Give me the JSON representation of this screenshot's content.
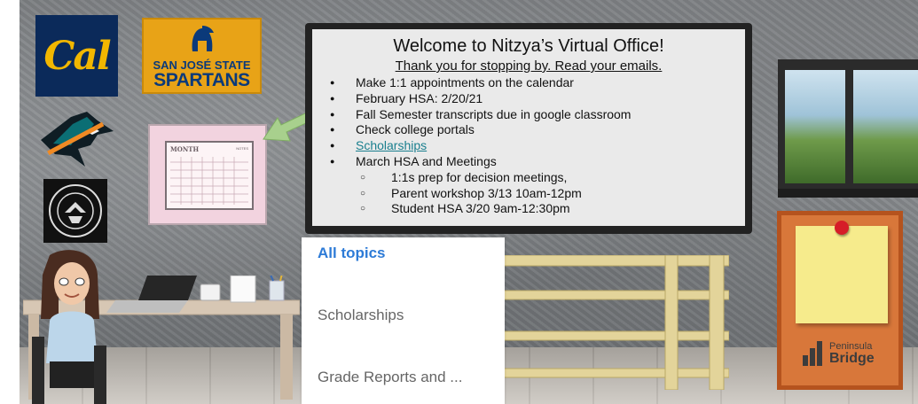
{
  "board": {
    "title": "Welcome to Nitzya’s Virtual Office!",
    "subtitle": "Thank you for stopping by.  Read your emails.",
    "items": [
      {
        "text": "Make 1:1 appointments on the calendar",
        "level": 1
      },
      {
        "text": "February HSA: 2/20/21",
        "level": 1
      },
      {
        "text": "Fall Semester transcripts due in google classroom",
        "level": 1
      },
      {
        "text": "Check college portals",
        "level": 1
      },
      {
        "text": "Scholarships",
        "level": 1,
        "link": true
      },
      {
        "text": "March HSA and Meetings",
        "level": 1
      },
      {
        "text": "1:1s prep for decision meetings,",
        "level": 2
      },
      {
        "text": "Parent workshop 3/13 10am-12pm",
        "level": 2
      },
      {
        "text": "Student HSA 3/20 9am-12:30pm",
        "level": 2
      }
    ]
  },
  "logos": {
    "cal": "Cal",
    "sjsu_line1": "SAN JOSÉ STATE",
    "sjsu_line2": "SPARTANS",
    "shark": "sharks-logo-icon",
    "seal": "association-seal-icon"
  },
  "calendar": {
    "month_label": "MONTH",
    "notes_label": "NOTES"
  },
  "corkboard": {
    "brand_line1": "Peninsula",
    "brand_line2": "Bridge"
  },
  "dropdown": {
    "items": [
      {
        "label": "All topics",
        "active": true
      },
      {
        "label": "Scholarships",
        "active": false
      },
      {
        "label": "Grade Reports and ...",
        "active": false
      }
    ]
  },
  "colors": {
    "accent": "#2d7bd7",
    "link": "#1a7f8e",
    "cal_blue": "#0b2a5a",
    "cal_gold": "#f2b700",
    "sjsu_gold": "#e8a317",
    "arrow_green": "#a8d08d",
    "note_yellow": "#f6eb8c",
    "calendar_pink": "#f2d3df"
  }
}
